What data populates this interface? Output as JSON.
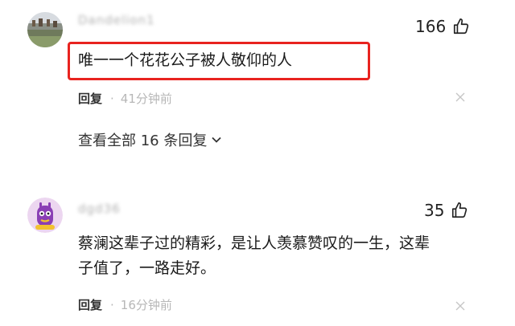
{
  "comments": [
    {
      "username": "Dandelion1",
      "likes": "166",
      "text": "唯一一个花花公子被人敬仰的人",
      "reply_label": "回复",
      "separator": "·",
      "time": "41分钟前",
      "expand_label": "查看全部 16 条回复"
    },
    {
      "username": "dgd36",
      "likes": "35",
      "text_line1": "蔡澜这辈子过的精彩，是让人羡慕赞叹的一生，这辈",
      "text_line2": "子值了，一路走好。",
      "reply_label": "回复",
      "separator": "·",
      "time": "16分钟前"
    }
  ],
  "icons": {
    "like": "thumbs-up-icon",
    "close": "close-icon",
    "expand": "chevron-down-icon"
  },
  "colors": {
    "highlight_border": "#e8231f",
    "meta_text": "#b7b7b7"
  }
}
